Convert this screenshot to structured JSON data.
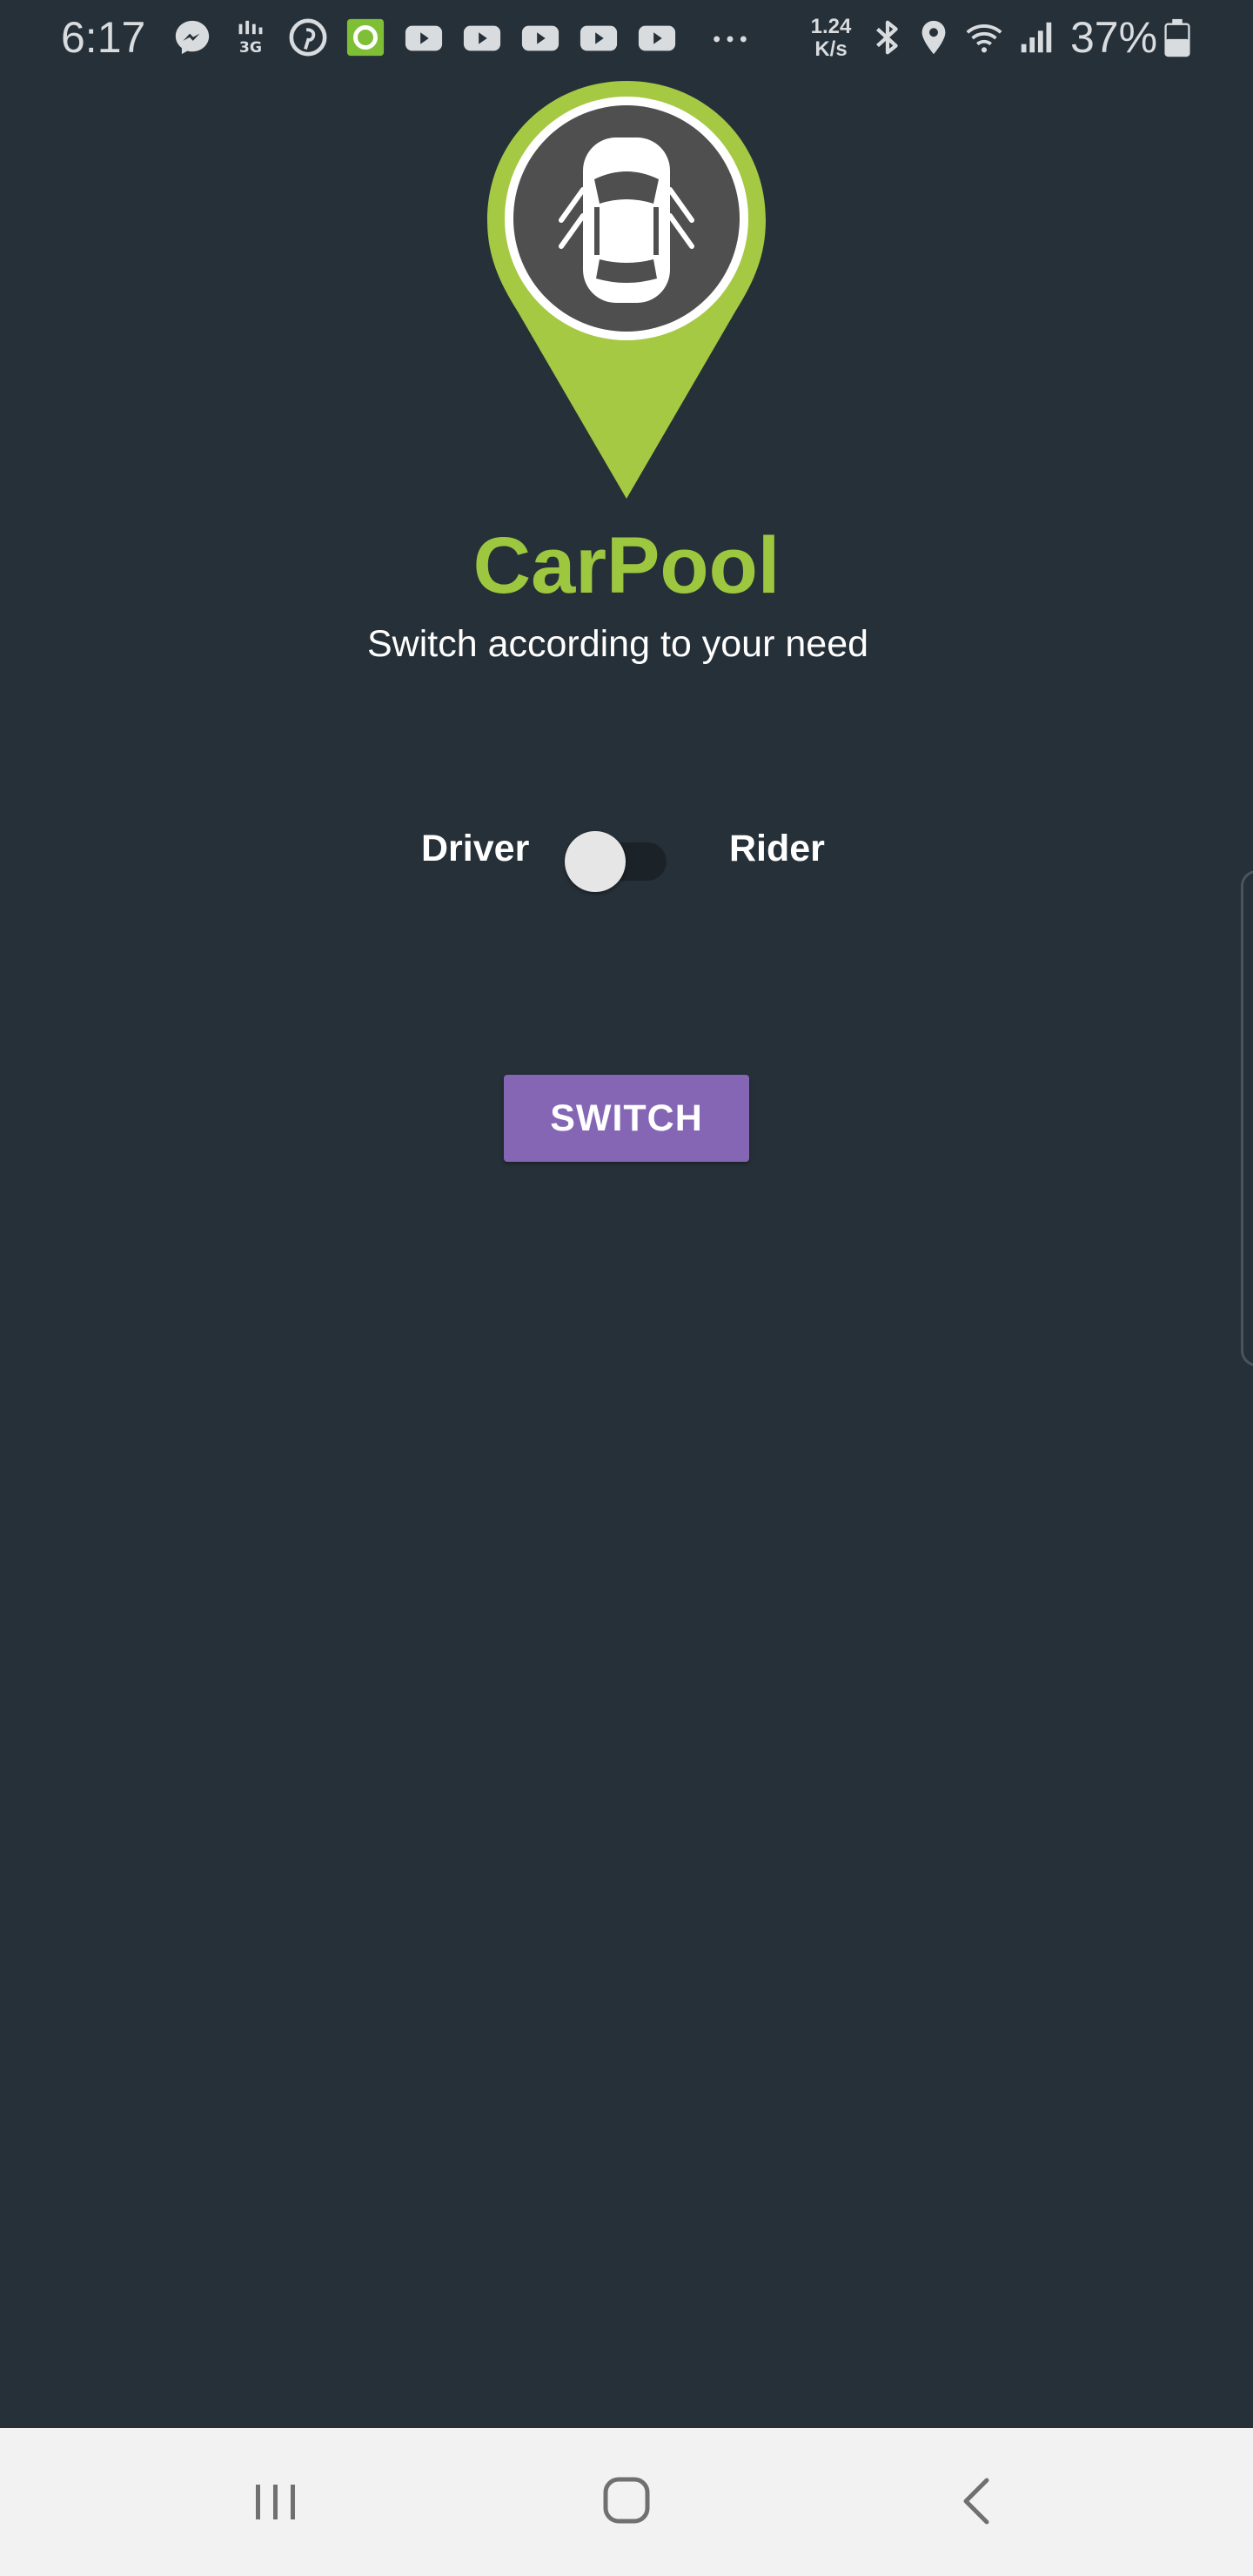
{
  "status_bar": {
    "time": "6:17",
    "speed_value": "1.24",
    "speed_unit": "K/s",
    "battery_percent": "37%",
    "icons": [
      "messenger-icon",
      "data-icon",
      "pinterest-icon",
      "app-icon",
      "youtube-icon",
      "youtube-icon",
      "youtube-icon",
      "youtube-icon",
      "youtube-icon",
      "more-icon",
      "bluetooth-icon",
      "location-icon",
      "wifi-icon",
      "signal-icon",
      "battery-icon"
    ]
  },
  "app": {
    "title": "CarPool",
    "subtitle": "Switch according to your need",
    "brand_color": "#9dc73f",
    "background_color": "#263038"
  },
  "mode_toggle": {
    "left_label": "Driver",
    "right_label": "Rider",
    "state": "off"
  },
  "switch_button": {
    "label": "SWITCH",
    "color": "#8466b4"
  },
  "nav_bar": {
    "buttons": [
      "recent-apps-icon",
      "home-icon",
      "back-icon"
    ]
  }
}
